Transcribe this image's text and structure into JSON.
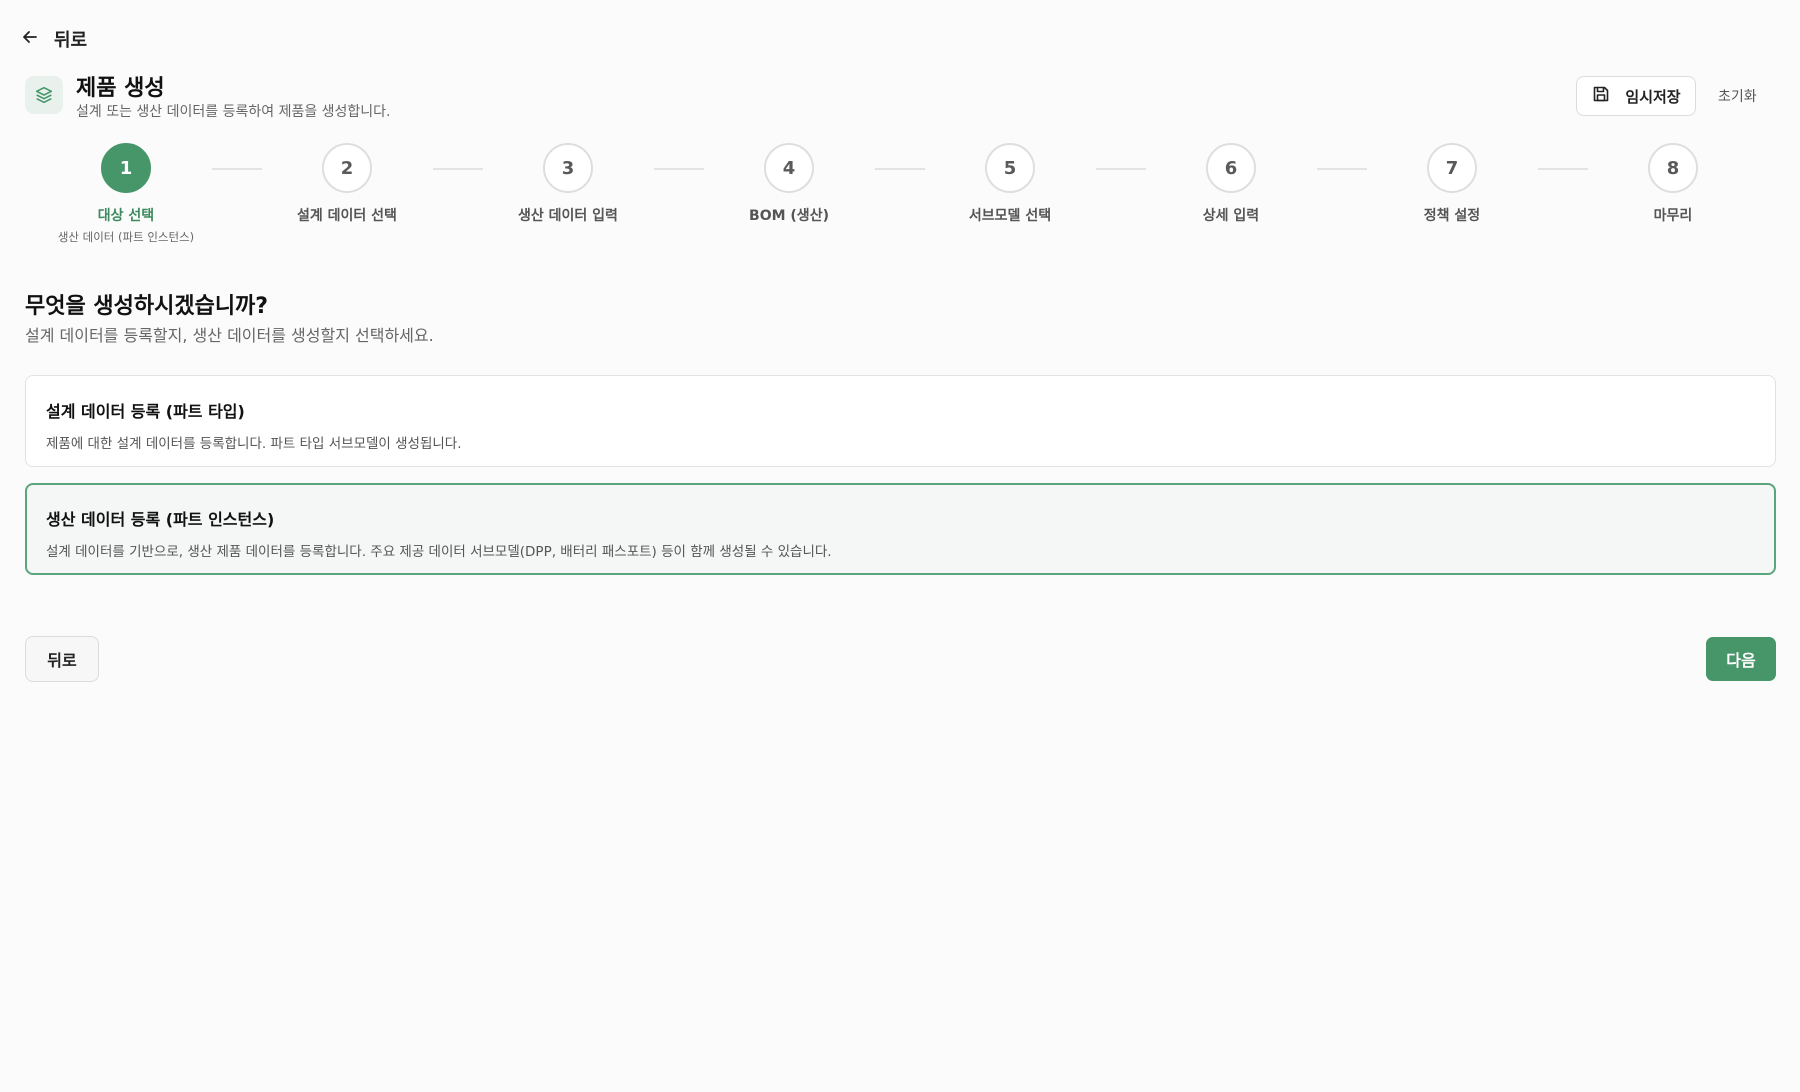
{
  "nav": {
    "back_label": "뒤로"
  },
  "header": {
    "title": "제품 생성",
    "subtitle": "설계 또는 생산 데이터를 등록하여 제품을 생성합니다.",
    "save_label": "임시저장",
    "reset_label": "초기화",
    "icon": "layers-icon"
  },
  "stepper": {
    "active_step": 1,
    "steps": [
      {
        "number": "1",
        "label": "대상 선택",
        "sublabel": "생산 데이터 (파트 인스턴스)"
      },
      {
        "number": "2",
        "label": "설계 데이터 선택"
      },
      {
        "number": "3",
        "label": "생산 데이터 입력"
      },
      {
        "number": "4",
        "label": "BOM (생산)"
      },
      {
        "number": "5",
        "label": "서브모델 선택"
      },
      {
        "number": "6",
        "label": "상세 입력"
      },
      {
        "number": "7",
        "label": "정책 설정"
      },
      {
        "number": "8",
        "label": "마무리"
      }
    ]
  },
  "main": {
    "question_title": "무엇을 생성하시겠습니까?",
    "question_desc": "설계 데이터를 등록할지, 생산 데이터를 생성할지 선택하세요.",
    "options": [
      {
        "title": "설계 데이터 등록 (파트 타입)",
        "desc": "제품에 대한 설계 데이터를 등록합니다. 파트 타입 서브모델이 생성됩니다.",
        "selected": false
      },
      {
        "title": "생산 데이터 등록 (파트 인스턴스)",
        "desc": "설계 데이터를 기반으로, 생산 제품 데이터를 등록합니다. 주요 제공 데이터 서브모델(DPP, 배터리 패스포트) 등이 함께 생성될 수 있습니다.",
        "selected": true
      }
    ]
  },
  "footer": {
    "back_label": "뒤로",
    "next_label": "다음"
  },
  "colors": {
    "accent": "#46966a",
    "selected_border": "#5aa57c",
    "selected_bg": "#f4f7f5"
  }
}
